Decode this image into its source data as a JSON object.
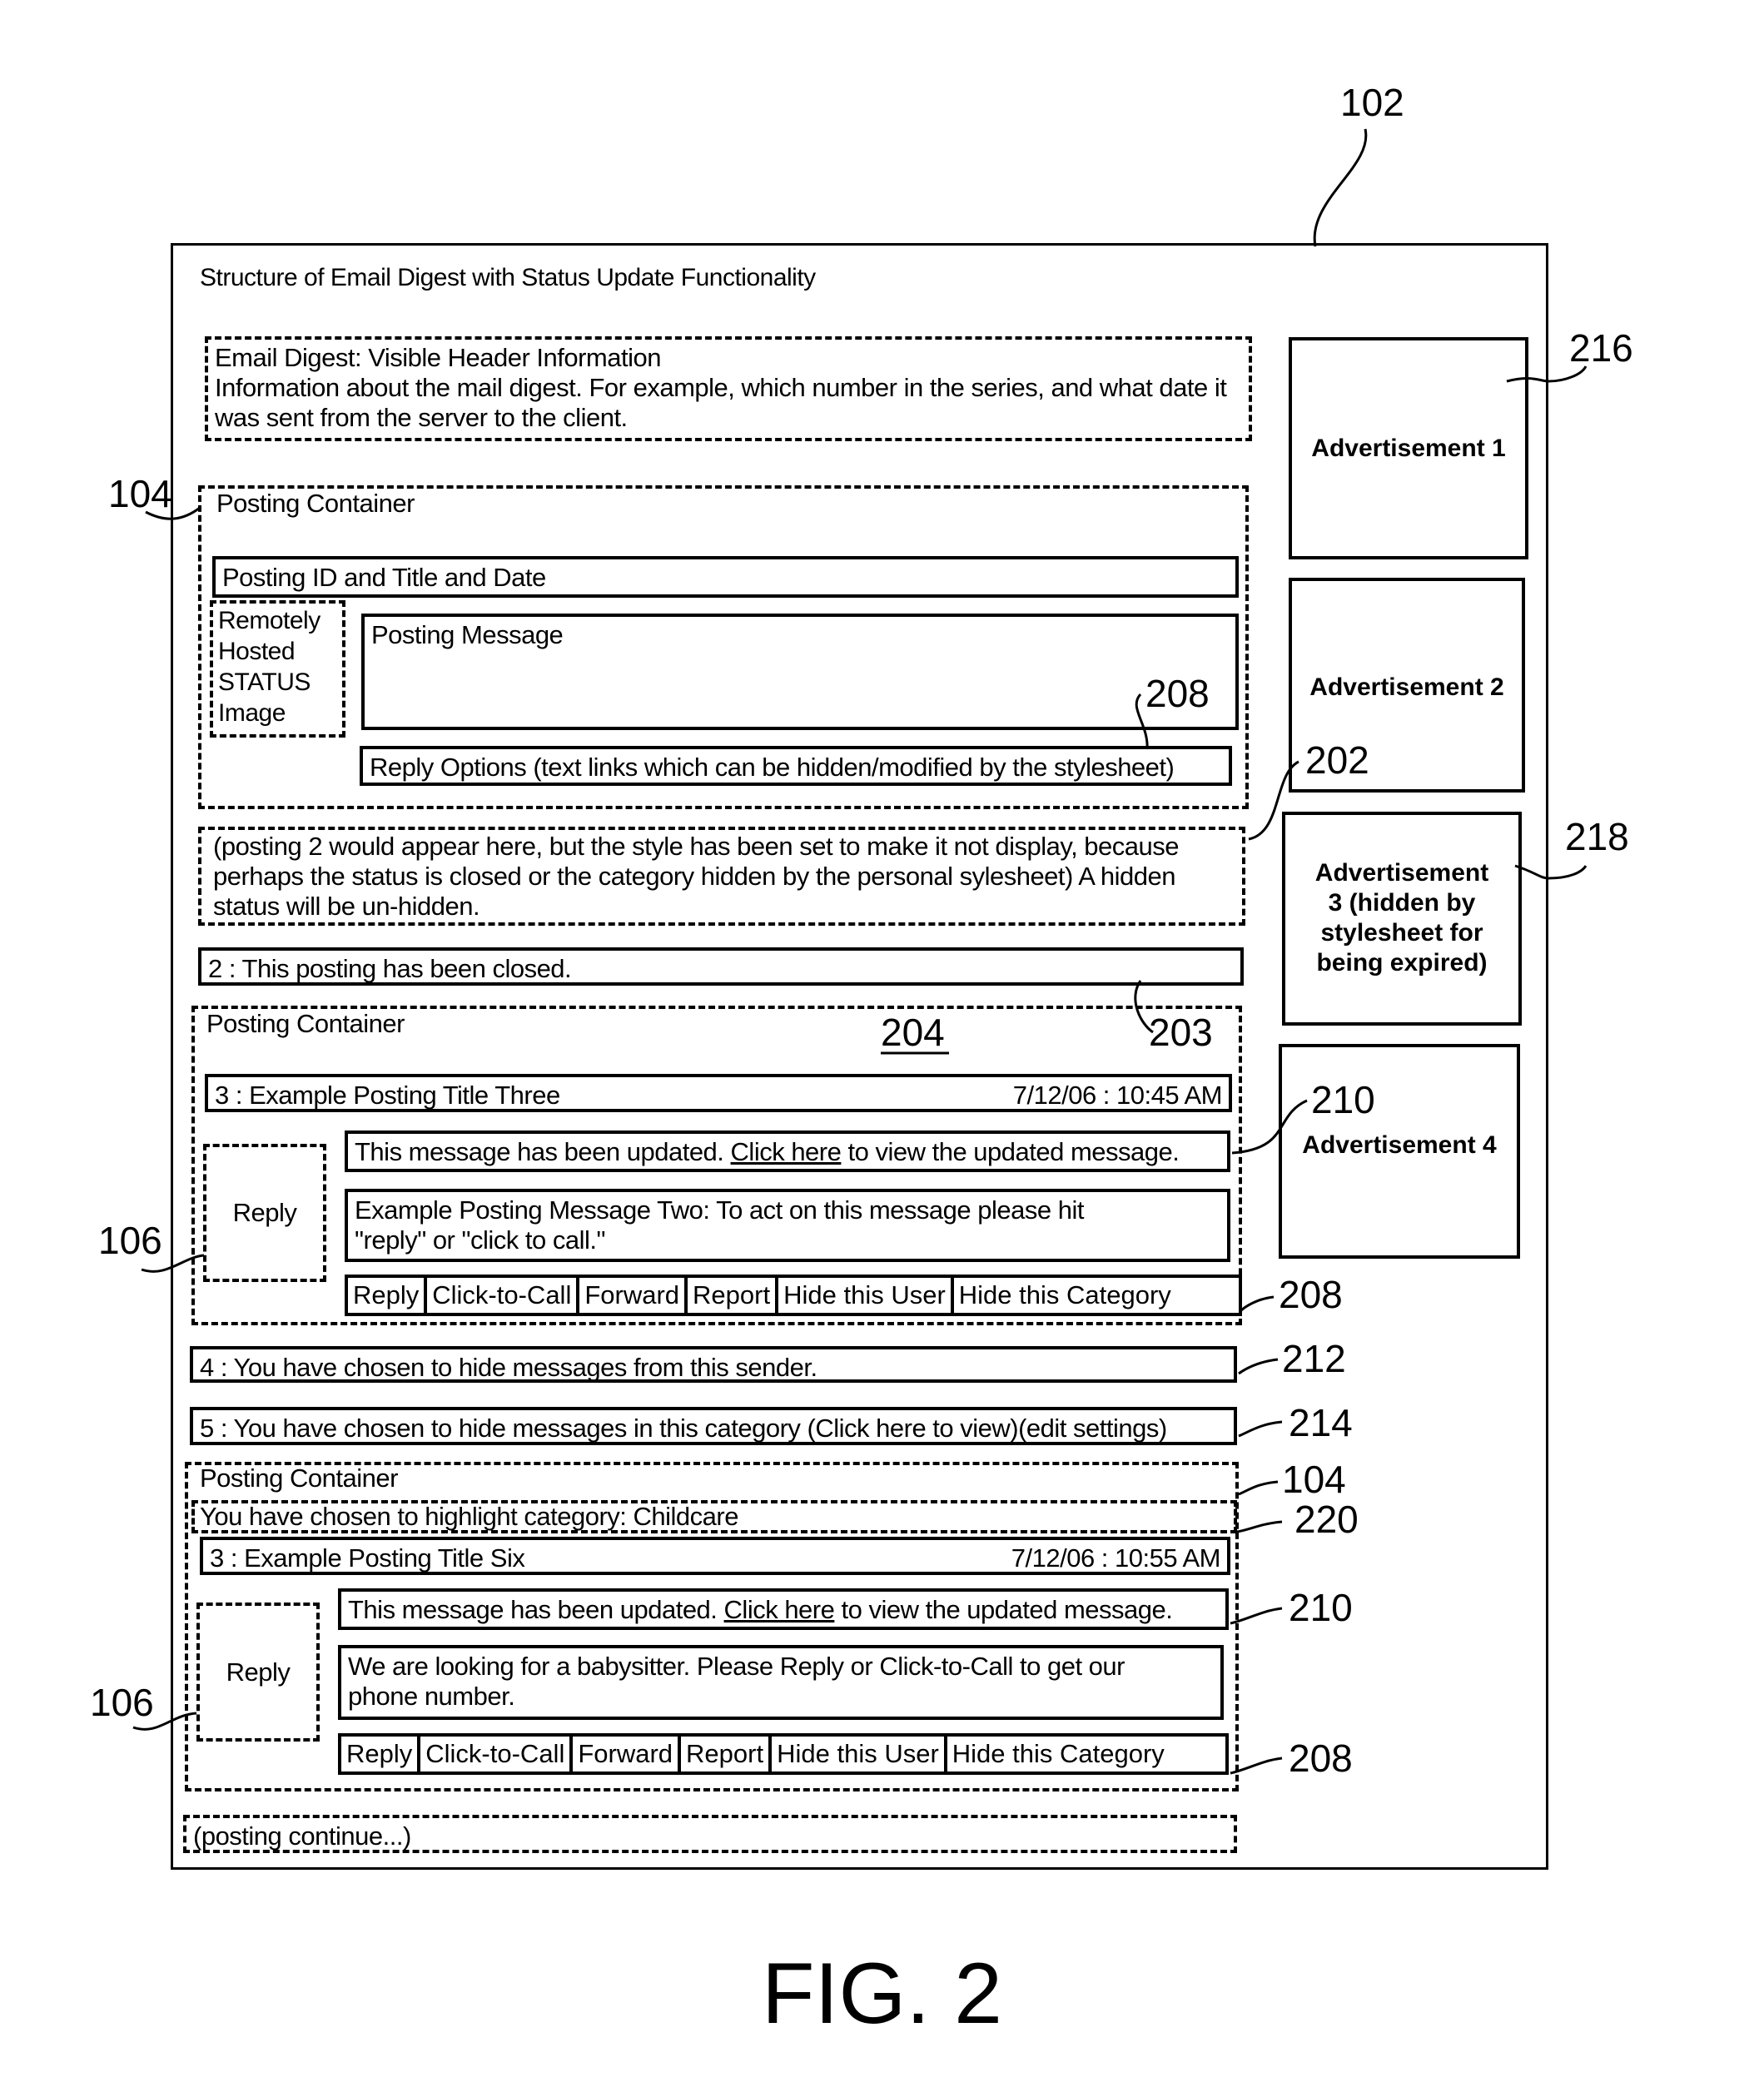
{
  "figure": {
    "caption": "FIG. 2",
    "title": "Structure of Email Digest with Status Update Functionality"
  },
  "header_box": {
    "title": "Email Digest: Visible Header Information",
    "body": "Information about the mail digest. For example, which number in the series, and what date it was sent from the server to the client."
  },
  "posting_container_1": {
    "label": "Posting Container",
    "title_bar": "Posting ID and Title and Date",
    "status_image": "Remotely Hosted STATUS Image",
    "message": "Posting Message",
    "reply_options": "Reply Options (text links which can be hidden/modified by the stylesheet)"
  },
  "hidden_posting_note": "(posting 2 would appear here, but the style has been set to make it not display, because perhaps the status is closed or the category hidden by the personal sylesheet) A hidden status will be un-hidden.",
  "closed_notice": "2 : This posting has been closed.",
  "posting_container_2": {
    "label": "Posting Container",
    "title": "3 : Example Posting Title Three",
    "date": "7/12/06 : 10:45 AM",
    "reply_button": "Reply",
    "update_prefix": "This message has been updated.",
    "update_link": "Click here",
    "update_suffix": "to view the updated message.",
    "message": "Example Posting Message Two: To act on this message please hit \"reply\" or \"click to call.\"",
    "actions": [
      "Reply",
      "Click-to-Call",
      "Forward",
      "Report",
      "Hide this User",
      "Hide this Category"
    ]
  },
  "hidden_sender_notice": "4 : You have chosen to hide messages from this sender.",
  "hidden_category_notice": "5 : You have chosen to hide messages in this category (Click here to view)(edit settings)",
  "posting_container_3": {
    "label": "Posting Container",
    "highlight": "You have chosen to highlight category: Childcare",
    "title": "3 : Example Posting Title Six",
    "date": "7/12/06 : 10:55 AM",
    "reply_button": "Reply",
    "update_prefix": "This message has been updated.",
    "update_link": "Click here",
    "update_suffix": "to view the updated message.",
    "message": "We are looking for a babysitter. Please Reply or Click-to-Call to get our phone number.",
    "actions": [
      "Reply",
      "Click-to-Call",
      "Forward",
      "Report",
      "Hide this User",
      "Hide this Category"
    ]
  },
  "continue_note": "(posting continue...)",
  "advertisements": [
    {
      "label": "Advertisement 1"
    },
    {
      "label": "Advertisement 2"
    },
    {
      "label": "Advertisement 3 (hidden by stylesheet for being expired)"
    },
    {
      "label": "Advertisement 4"
    }
  ],
  "reference_numerals": {
    "frame": "102",
    "posting_container_top": "104",
    "posting_container_bottom": "104",
    "reply_box_1": "106",
    "reply_box_2": "106",
    "hidden_posting": "202",
    "closed": "203",
    "container_2": "204",
    "reply_options_1": "208",
    "actions_2": "208",
    "actions_3": "208",
    "update_2": "210",
    "update_3": "210",
    "hide_sender": "212",
    "hide_category": "214",
    "ad_1": "216",
    "ad_3": "218",
    "highlight": "220"
  }
}
